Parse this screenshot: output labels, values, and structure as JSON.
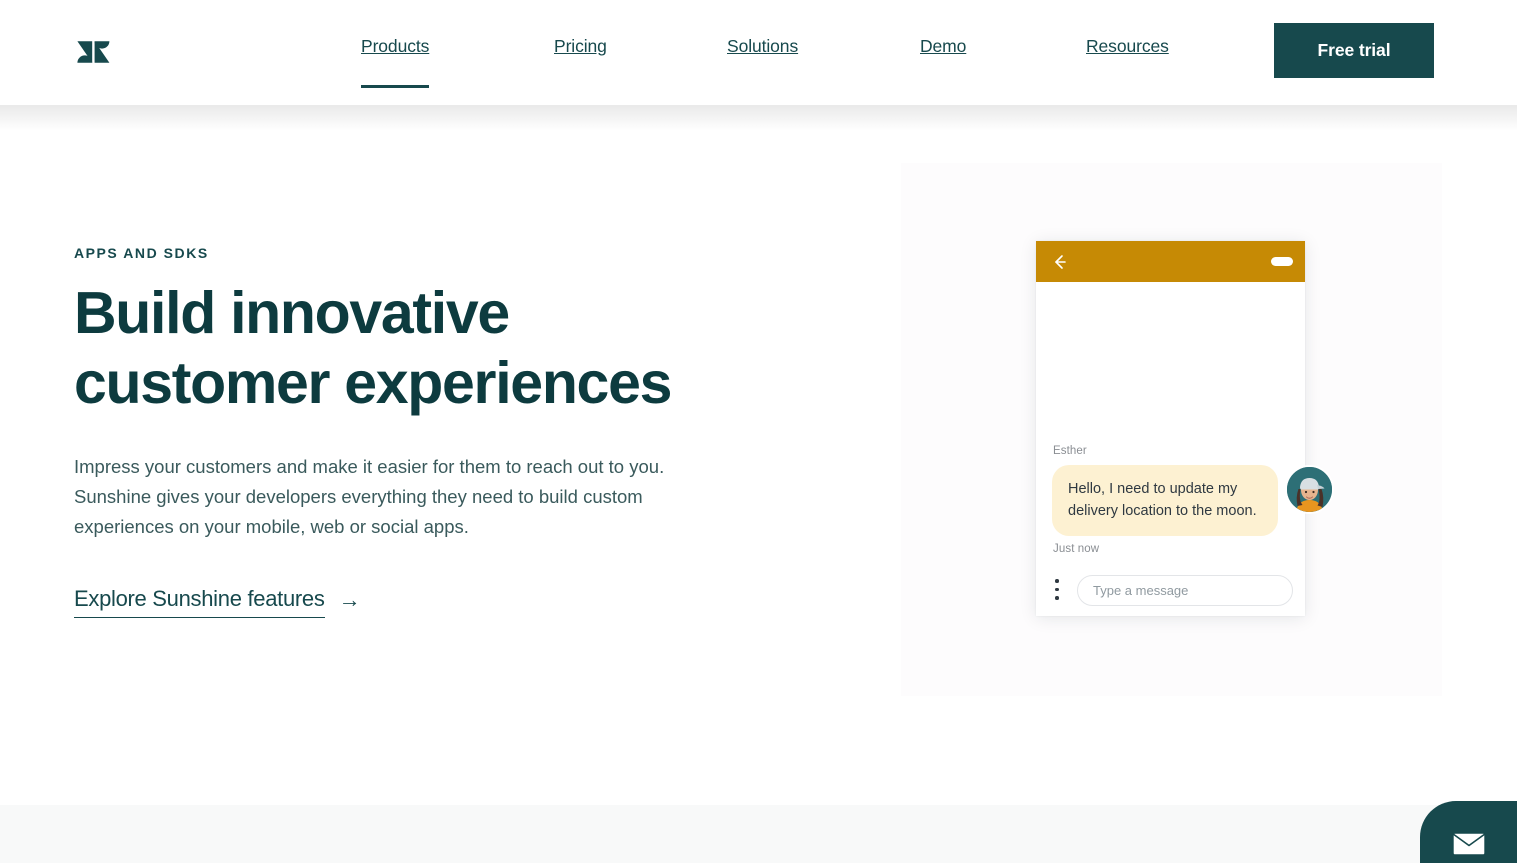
{
  "header": {
    "logo_name": "zendesk-logo",
    "nav": [
      {
        "label": "Products",
        "active": true
      },
      {
        "label": "Pricing",
        "active": false
      },
      {
        "label": "Solutions",
        "active": false
      },
      {
        "label": "Demo",
        "active": false
      },
      {
        "label": "Resources",
        "active": false
      }
    ],
    "free_trial_label": "Free trial"
  },
  "hero": {
    "eyebrow": "APPS AND SDKS",
    "title": "Build innovative customer experiences",
    "body": "Impress your customers and make it easier for them to reach out to you. Sunshine gives your developers everything they need to build custom experiences on your mobile, web or social apps.",
    "cta_label": "Explore Sunshine features",
    "cta_arrow": "→"
  },
  "chat_widget": {
    "back_icon": "arrow-left-icon",
    "minimize_icon": "minimize-icon",
    "sender": "Esther",
    "message": "Hello, I need to update my delivery location to the moon.",
    "timestamp": "Just now",
    "avatar_name": "esther-avatar",
    "menu_icon": "more-vertical-icon",
    "input_placeholder": "Type a message",
    "input_value": ""
  },
  "launcher": {
    "icon": "message-envelope-icon"
  },
  "colors": {
    "brand_dark": "#17494d",
    "heading": "#0d3b3f",
    "body_text": "#3a5a5c",
    "chat_header": "#c68a05",
    "bubble_bg": "#fdf1d2",
    "section_bg": "#f8f9f9",
    "panel_bg": "#fdfcfd"
  }
}
